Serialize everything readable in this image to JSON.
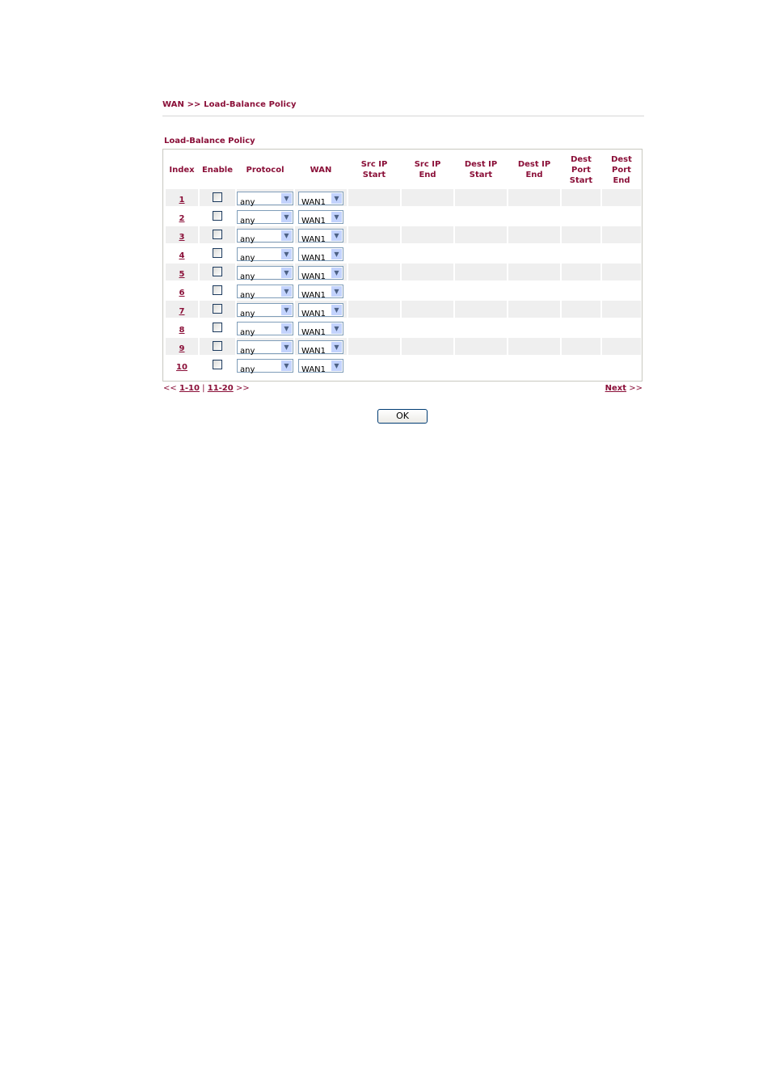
{
  "breadcrumb": "WAN >> Load-Balance Policy",
  "section_title": "Load-Balance Policy",
  "columns": [
    "Index",
    "Enable",
    "Protocol",
    "WAN",
    "Src IP\nStart",
    "Src IP\nEnd",
    "Dest IP\nStart",
    "Dest IP\nEnd",
    "Dest\nPort\nStart",
    "Dest\nPort\nEnd"
  ],
  "rows": [
    {
      "index": "1",
      "enabled": false,
      "protocol": "any",
      "wan": "WAN1"
    },
    {
      "index": "2",
      "enabled": false,
      "protocol": "any",
      "wan": "WAN1"
    },
    {
      "index": "3",
      "enabled": false,
      "protocol": "any",
      "wan": "WAN1"
    },
    {
      "index": "4",
      "enabled": false,
      "protocol": "any",
      "wan": "WAN1"
    },
    {
      "index": "5",
      "enabled": false,
      "protocol": "any",
      "wan": "WAN1"
    },
    {
      "index": "6",
      "enabled": false,
      "protocol": "any",
      "wan": "WAN1"
    },
    {
      "index": "7",
      "enabled": false,
      "protocol": "any",
      "wan": "WAN1"
    },
    {
      "index": "8",
      "enabled": false,
      "protocol": "any",
      "wan": "WAN1"
    },
    {
      "index": "9",
      "enabled": false,
      "protocol": "any",
      "wan": "WAN1"
    },
    {
      "index": "10",
      "enabled": false,
      "protocol": "any",
      "wan": "WAN1"
    }
  ],
  "pager": {
    "prev_symbol": "<<",
    "page1": "1-10",
    "separator": "|",
    "page2": "11-20",
    "next_symbol": ">>",
    "next_label": "Next",
    "next_arrows": ">>"
  },
  "ok_label": "OK",
  "icons": {
    "dropdown": "chevron-down-icon"
  }
}
